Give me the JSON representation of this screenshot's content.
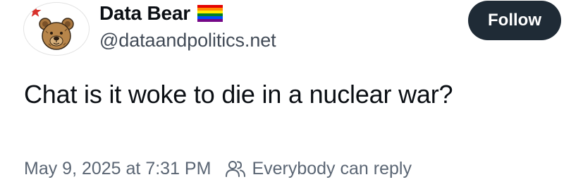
{
  "author": {
    "display_name": "Data Bear",
    "handle": "@dataandpolitics.net",
    "avatar_icon": "bear-avatar",
    "flag_icon": "rainbow-flag-icon"
  },
  "follow_button": {
    "label": "Follow",
    "color": "#1f2b36"
  },
  "post": {
    "text": "Chat is it woke to die in a nuclear war?",
    "timestamp": "May 9, 2025 at 7:31 PM",
    "reply_setting": "Everybody can reply",
    "reply_icon": "people-icon"
  }
}
